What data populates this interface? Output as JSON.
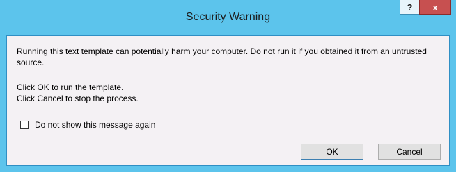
{
  "window": {
    "title": "Security Warning",
    "help_glyph": "?",
    "close_glyph": "x"
  },
  "message": {
    "line1": "Running this text template can potentially harm your computer. Do not run it if you obtained it from an untrusted source.",
    "line2": "Click OK to run the template.",
    "line3": "Click Cancel to stop the process."
  },
  "checkbox": {
    "label": "Do not show this message again",
    "checked": false
  },
  "buttons": {
    "ok": "OK",
    "cancel": "Cancel"
  },
  "colors": {
    "frame": "#5cc4ec",
    "client": "#f4f1f4",
    "close_button": "#c75050"
  }
}
